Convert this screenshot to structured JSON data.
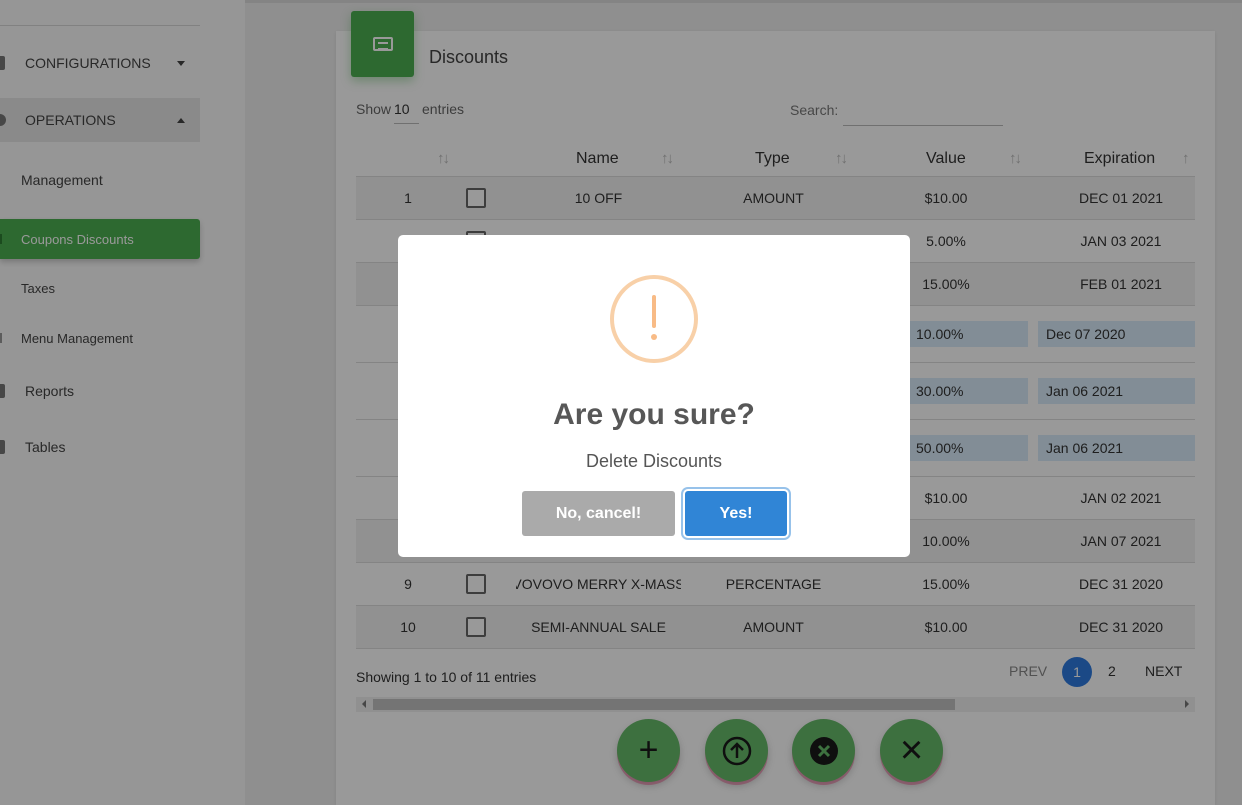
{
  "sidebar": {
    "configurations": "CONFIGURATIONS",
    "operations": "OPERATIONS",
    "management": "Management",
    "coupons_discounts": "Coupons Discounts",
    "taxes": "Taxes",
    "menu_management": "Menu Management",
    "reports": "Reports",
    "tables": "Tables"
  },
  "card": {
    "title": "Discounts",
    "show_label": "Show",
    "show_value": "10",
    "entries_label": "entries",
    "search_label": "Search:",
    "search_value": ""
  },
  "table": {
    "headers": [
      "Name",
      "Type",
      "Value",
      "Expiration"
    ],
    "rows": [
      {
        "num": "1",
        "name": "10 OFF",
        "type": "AMOUNT",
        "value": "$10.00",
        "expiration": "DEC 01 2021"
      },
      {
        "num": "",
        "name": "",
        "type": "",
        "value": "5.00%",
        "expiration": "JAN 03 2021"
      },
      {
        "num": "",
        "name": "",
        "type": "",
        "value": "15.00%",
        "expiration": "FEB 01 2021"
      },
      {
        "num": "",
        "name": "",
        "type": "",
        "value": "10.00%",
        "expiration": "Dec 07 2020"
      },
      {
        "num": "",
        "name": "",
        "type": "",
        "value": "30.00%",
        "expiration": "Jan 06 2021"
      },
      {
        "num": "",
        "name": "",
        "type": "",
        "value": "50.00%",
        "expiration": "Jan 06 2021"
      },
      {
        "num": "",
        "name": "",
        "type": "",
        "value": "$10.00",
        "expiration": "JAN 02 2021"
      },
      {
        "num": "",
        "name": "",
        "type": "",
        "value": "10.00%",
        "expiration": "JAN 07 2021"
      },
      {
        "num": "9",
        "name": "VOVOVO MERRY X-MASS",
        "type": "PERCENTAGE",
        "value": "15.00%",
        "expiration": "DEC 31 2020"
      },
      {
        "num": "10",
        "name": "SEMI-ANNUAL SALE",
        "type": "AMOUNT",
        "value": "$10.00",
        "expiration": "DEC 31 2020"
      }
    ]
  },
  "footer": {
    "showing": "Showing 1 to 10 of 11 entries",
    "prev": "PREV",
    "page1": "1",
    "page2": "2",
    "next": "NEXT"
  },
  "fabs": {
    "add": "+",
    "upload": "upload-icon",
    "remove": "remove-icon",
    "close": "×"
  },
  "modal": {
    "title": "Are you sure?",
    "text": "Delete Discounts",
    "cancel": "No, cancel!",
    "confirm": "Yes!"
  },
  "colors": {
    "green": "#4caf50",
    "fab_green": "#66bb6a",
    "confirm_blue": "#3085d6",
    "cancel_gray": "#aaaaaa",
    "warning_orange": "#f8bb86"
  }
}
